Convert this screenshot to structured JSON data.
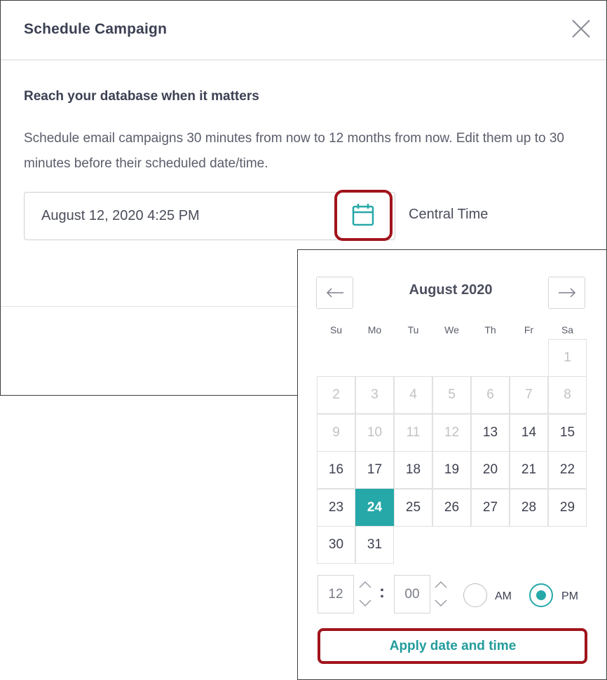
{
  "modal": {
    "title": "Schedule Campaign",
    "subhead": "Reach your database when it matters",
    "description": "Schedule email campaigns 30 minutes from now to 12 months from now. Edit them up to 30 minutes before their scheduled date/time.",
    "date_value": "August 12, 2020 4:25 PM",
    "timezone": "Central Time"
  },
  "picker": {
    "month_label": "August 2020",
    "weekdays": [
      "Su",
      "Mo",
      "Tu",
      "We",
      "Th",
      "Fr",
      "Sa"
    ],
    "weeks": [
      [
        "",
        "",
        "",
        "",
        "",
        "",
        "1"
      ],
      [
        "2",
        "3",
        "4",
        "5",
        "6",
        "7",
        "8"
      ],
      [
        "9",
        "10",
        "11",
        "12",
        "13",
        "14",
        "15"
      ],
      [
        "16",
        "17",
        "18",
        "19",
        "20",
        "21",
        "22"
      ],
      [
        "23",
        "24",
        "25",
        "26",
        "27",
        "28",
        "29"
      ],
      [
        "30",
        "31",
        "",
        "",
        "",
        "",
        ""
      ]
    ],
    "disabled_days": [
      "1",
      "2",
      "3",
      "4",
      "5",
      "6",
      "7",
      "8",
      "9",
      "10",
      "11",
      "12"
    ],
    "selected_day": "24",
    "hour": "12",
    "minute": "00",
    "colon": ":",
    "am_label": "AM",
    "pm_label": "PM",
    "period_selected": "PM",
    "apply_label": "Apply date and time"
  },
  "colors": {
    "accent": "#26a8a8",
    "highlight_ring": "#a1141c",
    "text_dark": "#3c4053",
    "disabled": "#c2c2c2"
  },
  "icons": {
    "close": "close-icon",
    "calendar": "calendar-icon",
    "prev": "arrow-left-icon",
    "next": "arrow-right-icon",
    "spin_up": "chevron-up-icon",
    "spin_down": "chevron-down-icon"
  }
}
